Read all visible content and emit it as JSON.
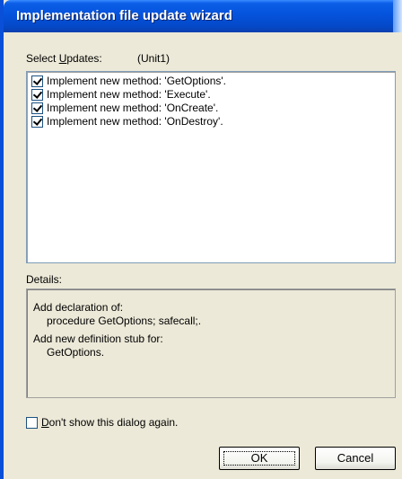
{
  "window": {
    "title": "Implementation file update wizard"
  },
  "updates": {
    "label_prefix": "Select ",
    "label_accel": "U",
    "label_rest": "pdates:",
    "unit": "(Unit1)",
    "items": [
      {
        "label": "Implement new method: 'GetOptions'.",
        "checked": true
      },
      {
        "label": "Implement new method: 'Execute'.",
        "checked": true
      },
      {
        "label": "Implement new method: 'OnCreate'.",
        "checked": true
      },
      {
        "label": "Implement new method: 'OnDestroy'.",
        "checked": true
      }
    ]
  },
  "details": {
    "label": "Details:",
    "lines": [
      "Add declaration of:",
      "procedure GetOptions; safecall;.",
      "Add new definition stub for:",
      "GetOptions."
    ]
  },
  "dont_show": {
    "accel": "D",
    "rest": "on't show this dialog again.",
    "checked": false
  },
  "buttons": {
    "ok": "OK",
    "cancel": "Cancel"
  }
}
